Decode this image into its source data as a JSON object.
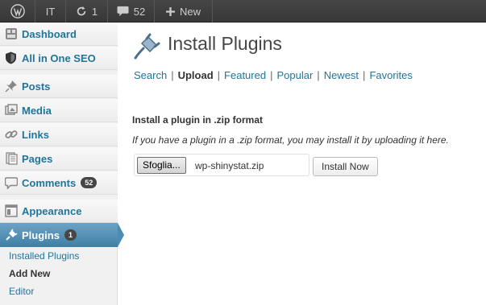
{
  "adminbar": {
    "wp_icon": "wordpress-logo-icon",
    "site_label": "IT",
    "updates_count": "1",
    "comments_count": "52",
    "new_label": "New"
  },
  "sidebar": {
    "items": [
      {
        "label": "Dashboard",
        "icon": "dashboard-icon"
      },
      {
        "label": "All in One SEO",
        "icon": "shield-icon"
      },
      {
        "label": "Posts",
        "icon": "pushpin-icon"
      },
      {
        "label": "Media",
        "icon": "media-icon"
      },
      {
        "label": "Links",
        "icon": "link-icon"
      },
      {
        "label": "Pages",
        "icon": "pages-icon"
      },
      {
        "label": "Comments",
        "icon": "comment-icon",
        "badge": "52"
      },
      {
        "label": "Appearance",
        "icon": "appearance-icon"
      },
      {
        "label": "Plugins",
        "icon": "plug-icon",
        "badge": "1"
      }
    ],
    "submenu": [
      "Installed Plugins",
      "Add New",
      "Editor"
    ]
  },
  "main": {
    "title": "Install Plugins",
    "tabs": [
      "Search",
      "Upload",
      "Featured",
      "Popular",
      "Newest",
      "Favorites"
    ],
    "tab_separator": "|",
    "upload_heading": "Install a plugin in .zip format",
    "upload_description": "If you have a plugin in a .zip format, you may install it by uploading it here.",
    "browse_label": "Sfoglia...",
    "file_name": "wp-shinystat.zip",
    "install_button": "Install Now"
  },
  "colors": {
    "link": "#21759b",
    "adminbar": "#464646",
    "active_menu": "#4c8bb2"
  }
}
